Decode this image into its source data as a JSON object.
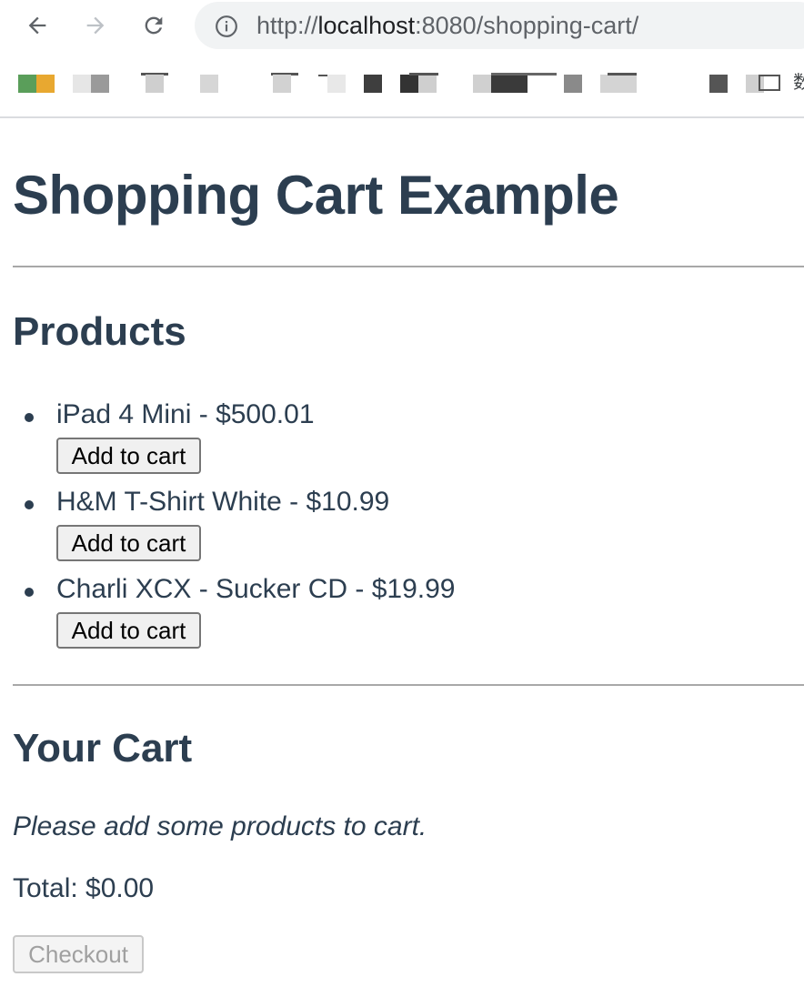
{
  "browser": {
    "url_prefix": "http://",
    "url_host": "localhost",
    "url_rest": ":8080/shopping-cart/",
    "bookmark_label": "数"
  },
  "page": {
    "title": "Shopping Cart Example"
  },
  "products": {
    "heading": "Products",
    "items": [
      {
        "label": "iPad 4 Mini - $500.01",
        "button": "Add to cart"
      },
      {
        "label": "H&M T-Shirt White - $10.99",
        "button": "Add to cart"
      },
      {
        "label": "Charli XCX - Sucker CD - $19.99",
        "button": "Add to cart"
      }
    ]
  },
  "cart": {
    "heading": "Your Cart",
    "empty_message": "Please add some products to cart.",
    "total": "Total: $0.00",
    "checkout_label": "Checkout"
  }
}
